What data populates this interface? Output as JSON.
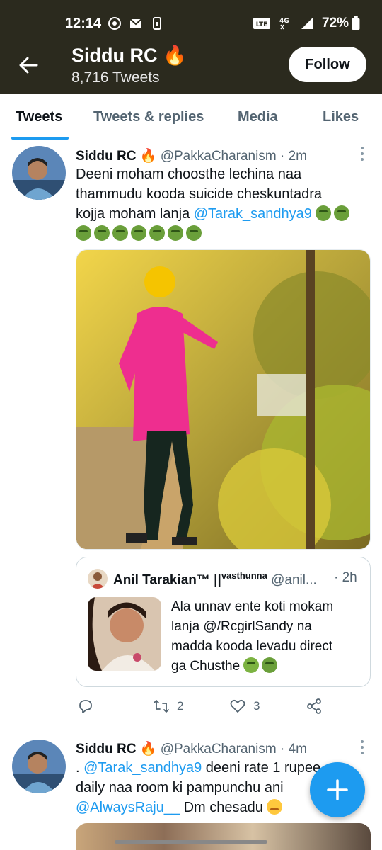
{
  "status_bar": {
    "time": "12:14",
    "network": "4G",
    "volte": "Vo LTE 2",
    "battery": "72%"
  },
  "header": {
    "title": "Siddu RC 🔥",
    "tweet_count": "8,716 Tweets",
    "follow_label": "Follow"
  },
  "tabs": [
    {
      "label": "Tweets",
      "active": true
    },
    {
      "label": "Tweets & replies",
      "active": false
    },
    {
      "label": "Media",
      "active": false
    },
    {
      "label": "Likes",
      "active": false
    }
  ],
  "tweets": [
    {
      "name": "Siddu RC 🔥",
      "handle": "@PakkaCharanism",
      "time": "· 2m",
      "text_line1": "Deeni moham choosthe lechina naa",
      "text_line2": "thammudu kooda suicide cheskuntadra",
      "text_line3_prefix": "kojja moham lanja ",
      "text_line3_mention": "@Tarak_sandhya9",
      "quote": {
        "name": "Anil Tarakian™ ||",
        "name_sup": "vasthunna",
        "handle": "@anil...",
        "time": "· 2h",
        "text_line1": "Ala unnav ente koti mokam",
        "text_line2": "lanja @/RcgirlSandy na",
        "text_line3": "madda kooda levadu direct",
        "text_line4": "ga Chusthe"
      },
      "retweets": "2",
      "likes": "3"
    },
    {
      "name": "Siddu RC 🔥",
      "handle": "@PakkaCharanism",
      "time": "· 4m",
      "text_line1_prefix": ". ",
      "text_line1_mention": "@Tarak_sandhya9",
      "text_line1_suffix": " deeni rate 1 rupee ",
      "text_line2": "daily naa room ki pampunchu ani",
      "text_line3_mention": "@AlwaysRaju__",
      "text_line3_suffix": " Dm chesadu "
    }
  ],
  "colors": {
    "header_bg": "#2b2a1e",
    "accent": "#1d9bf0",
    "secondary_text": "#536471"
  }
}
